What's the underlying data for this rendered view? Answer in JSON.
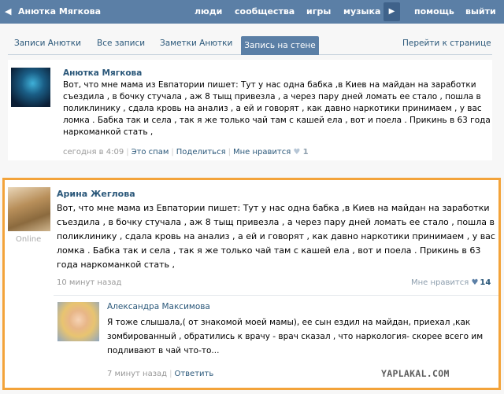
{
  "topbar": {
    "back_glyph": "◀",
    "user_name": "Анютка Мягкова",
    "nav": [
      "люди",
      "сообщества",
      "игры",
      "музыка",
      "помощь",
      "выйти"
    ],
    "play_glyph": "▶"
  },
  "tabs": {
    "items": [
      "Записи Анютки",
      "Все записи",
      "Заметки Анютки"
    ],
    "active": "Запись на стене",
    "right": "Перейти к странице"
  },
  "post": {
    "author": "Анютка Мягкова",
    "text": "Вот, что мне мама из Евпатории пишет: Тут у нас одна бабка ,в Киев на майдан на заработки съездила , в бочку стучала , аж 8 тыщ привезла , а через пару дней ломать ее стало , пошла в поликлинику , сдала кровь на анализ , а ей и говорят , как давно наркотики принимаем , у вас ломка . Бабка так и села , так я же только чай там с кашей ела , вот и поела . Прикинь в 63 года наркоманкой стать ,",
    "time": "сегодня в 4:09",
    "spam": "Это спам",
    "share": "Поделиться",
    "like_label": "Мне нравится",
    "like_count": "1"
  },
  "comment": {
    "author": "Арина Жеглова",
    "status": "Online",
    "text": "Вот, что мне мама из Евпатории пишет: Тут у нас одна бабка ,в Киев на майдан на заработки съездила , в бочку стучала , аж 8 тыщ привезла , а через пару дней ломать ее стало , пошла в поликлинику , сдала кровь на анализ , а ей и говорят , как давно наркотики принимаем , у вас ломка . Бабка так и села , так я же только чай там с кашей ела , вот и поела . Прикинь в 63 года наркоманкой стать ,",
    "time": "10 минут назад",
    "like_label": "Мне нравится",
    "like_count": "14"
  },
  "reply": {
    "author": "Александра Максимова",
    "text": "Я тоже слышала,( от знакомой моей мамы), ее сын ездил на майдан, приехал ,как зомбированный , обратились к врачу - врач сказал , что наркология- скорее всего им подливают в чай что-то...",
    "time": "7 минут назад",
    "reply_label": "Ответить"
  },
  "watermark": "YAPLAKAL.COM",
  "colors": {
    "header": "#5b7fa6",
    "link": "#2b587a",
    "highlight_border": "#f3a33a"
  }
}
